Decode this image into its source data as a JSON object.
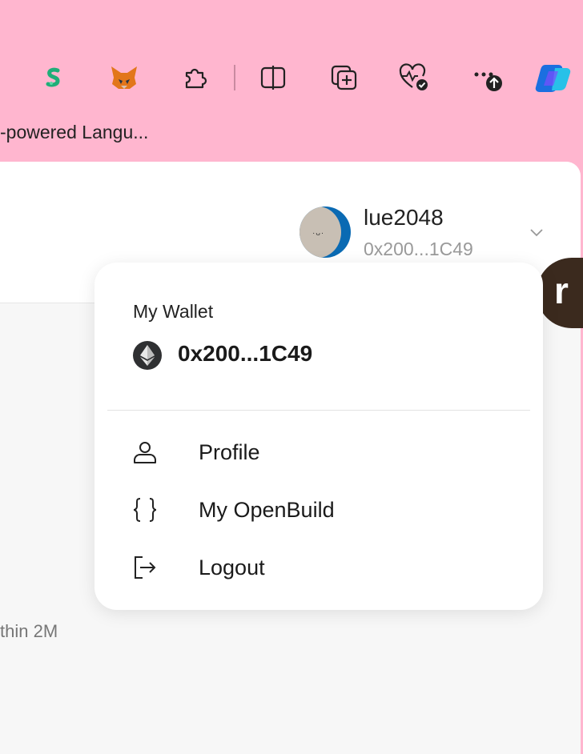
{
  "toolbar": {
    "icons": [
      "extension-s-icon",
      "metamask-fox-icon",
      "puzzle-icon",
      "split-screen-icon",
      "add-collection-icon",
      "browser-health-icon",
      "more-icon",
      "copilot-icon"
    ]
  },
  "bookmark": {
    "label": "-powered Langu..."
  },
  "user": {
    "name": "lue2048",
    "address": "0x200...1C49"
  },
  "background": {
    "text": "thin 2M"
  },
  "floating_button": {
    "letter": "r"
  },
  "menu": {
    "wallet_label": "My Wallet",
    "wallet_address": "0x200...1C49",
    "items": [
      {
        "label": "Profile",
        "icon": "person-icon"
      },
      {
        "label": "My OpenBuild",
        "icon": "braces-icon"
      },
      {
        "label": "Logout",
        "icon": "logout-icon"
      }
    ]
  },
  "colors": {
    "toolbar_bg": "#ffb6cf",
    "menu_bg": "#ffffff",
    "avatar_blue": "#0a6ab3"
  }
}
